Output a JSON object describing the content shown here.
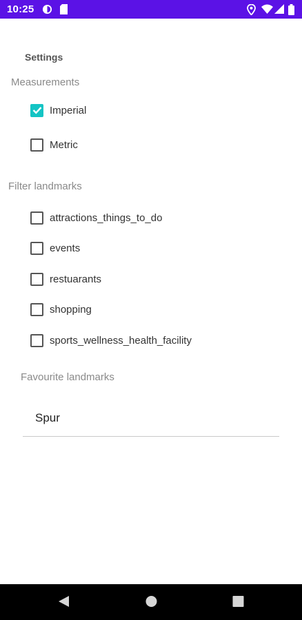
{
  "status_bar": {
    "time": "10:25",
    "left_icons": [
      "data-saver-icon",
      "sd-card-icon"
    ],
    "right_icons": [
      "location-icon",
      "wifi-icon",
      "signal-icon",
      "battery-icon"
    ],
    "color": "#5b12e6"
  },
  "settings": {
    "title": "Settings",
    "measurements": {
      "label": "Measurements",
      "options": [
        {
          "label": "Imperial",
          "checked": true
        },
        {
          "label": "Metric",
          "checked": false
        }
      ]
    },
    "filter_landmarks": {
      "label": "Filter landmarks",
      "options": [
        {
          "label": "attractions_things_to_do",
          "checked": false
        },
        {
          "label": "events",
          "checked": false
        },
        {
          "label": "restuarants",
          "checked": false
        },
        {
          "label": "shopping",
          "checked": false
        },
        {
          "label": "sports_wellness_health_facility",
          "checked": false
        }
      ]
    },
    "favourite_landmarks": {
      "label": "Favourite landmarks",
      "value": "Spur"
    }
  },
  "navigation_bar": {
    "buttons": [
      "back-icon",
      "home-icon",
      "recents-icon"
    ]
  },
  "accent_color": "#14c4c4"
}
